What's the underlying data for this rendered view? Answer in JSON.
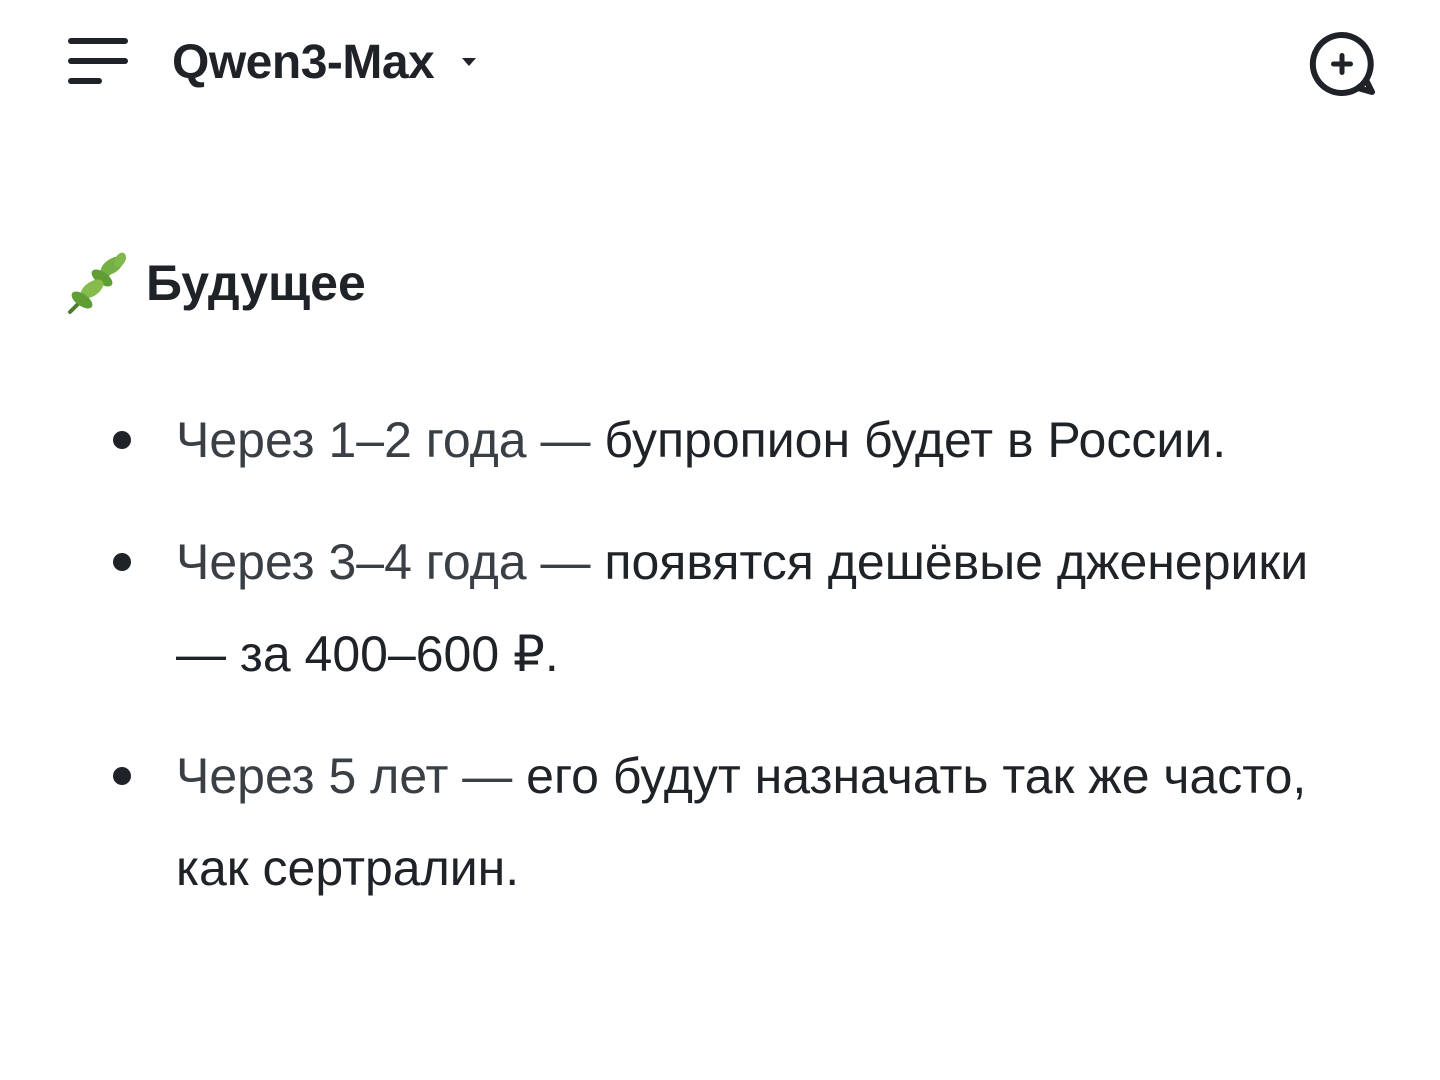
{
  "header": {
    "model_name": "Qwen3-Max",
    "menu_icon": "menu-icon",
    "caret_icon": "caret-down-icon",
    "new_chat_icon": "new-chat-icon"
  },
  "section": {
    "emoji_icon": "herb-leaf-icon",
    "title": "Будущее"
  },
  "bullets": [
    {
      "lead": "Через 1–2 года — ",
      "text": "бупропион будет в России."
    },
    {
      "lead": "Через 3–4 года — ",
      "text": "появятся дешёвые дженерики — за 400–600 ₽."
    },
    {
      "lead": "Через 5 лет — ",
      "text": "его будут назначать так же часто, как сертралин."
    }
  ],
  "colors": {
    "text": "#1f2328",
    "muted_text": "#3a3f45",
    "background": "#ffffff",
    "leaf_green": "#5f9e35"
  }
}
